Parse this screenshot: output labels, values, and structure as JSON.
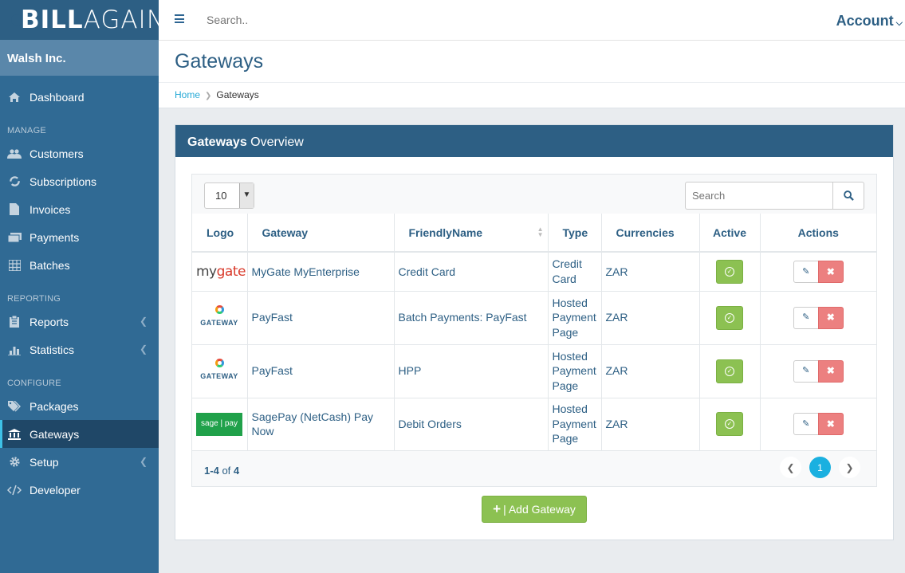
{
  "brand": {
    "bold": "BILL",
    "light": "AGAIN"
  },
  "org_name": "Walsh Inc.",
  "sidebar": {
    "dashboard": "Dashboard",
    "sections": [
      {
        "title": "MANAGE",
        "items": [
          {
            "label": "Customers",
            "icon": "users-icon"
          },
          {
            "label": "Subscriptions",
            "icon": "refresh-icon"
          },
          {
            "label": "Invoices",
            "icon": "file-icon"
          },
          {
            "label": "Payments",
            "icon": "money-icon"
          },
          {
            "label": "Batches",
            "icon": "table-icon"
          }
        ]
      },
      {
        "title": "REPORTING",
        "items": [
          {
            "label": "Reports",
            "icon": "clipboard-icon"
          },
          {
            "label": "Statistics",
            "icon": "bar-chart-icon"
          }
        ]
      },
      {
        "title": "CONFIGURE",
        "items": [
          {
            "label": "Packages",
            "icon": "tags-icon"
          },
          {
            "label": "Gateways",
            "icon": "bank-icon"
          },
          {
            "label": "Setup",
            "icon": "gear-icon"
          },
          {
            "label": "Developer",
            "icon": "code-icon"
          }
        ]
      }
    ]
  },
  "topbar": {
    "search_placeholder": "Search..",
    "account": "Account"
  },
  "page": {
    "title": "Gateways",
    "breadcrumb": {
      "home": "Home",
      "current": "Gateways"
    }
  },
  "panel": {
    "title_bold": "Gateways",
    "title_rest": " Overview"
  },
  "table": {
    "page_length": "10",
    "search_placeholder": "Search",
    "columns": [
      "Logo",
      "Gateway",
      "FriendlyName",
      "Type",
      "Currencies",
      "Active",
      "Actions"
    ],
    "rows": [
      {
        "logo": "mygate",
        "gateway": "MyGate MyEnterprise",
        "friendly": "Credit Card",
        "type": "Credit Card",
        "currency": "ZAR",
        "active": true
      },
      {
        "logo": "payfast",
        "gateway": "PayFast",
        "friendly": "Batch Payments: PayFast",
        "type": "Hosted Payment Page",
        "currency": "ZAR",
        "active": true
      },
      {
        "logo": "payfast",
        "gateway": "PayFast",
        "friendly": "HPP",
        "type": "Hosted Payment Page",
        "currency": "ZAR",
        "active": true
      },
      {
        "logo": "sagepay",
        "gateway": "SagePay (NetCash) Pay Now",
        "friendly": "Debit Orders",
        "type": "Hosted Payment Page",
        "currency": "ZAR",
        "active": true
      }
    ],
    "footer": {
      "from": "1",
      "to": "4",
      "of_word": "of",
      "total": "4"
    },
    "current_page": "1"
  },
  "logos": {
    "mygate_a": "my",
    "mygate_b": "gate",
    "gateway_text": "GATEWAY",
    "sage_a": "sage",
    "sage_b": "pay"
  },
  "add_button": "| Add Gateway",
  "colors": {
    "sidebar": "#306a94",
    "header": "#2d5f84",
    "active_accent": "#3ec1e6",
    "success": "#8cc152",
    "danger": "#ec8080"
  }
}
